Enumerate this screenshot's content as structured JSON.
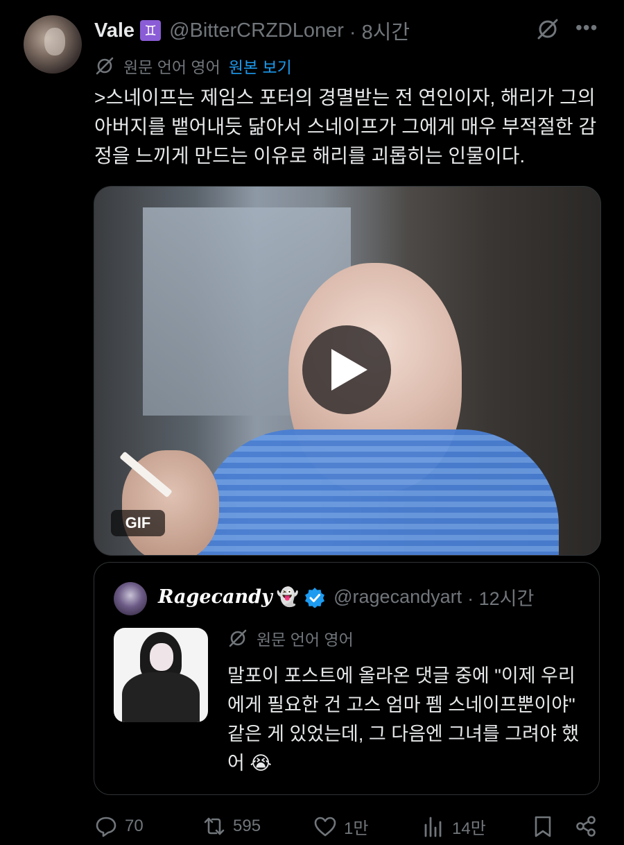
{
  "author": {
    "name": "Vale",
    "zodiac": "♊",
    "handle": "@BitterCRZDLoner",
    "time": "· 8시간"
  },
  "translation": {
    "label": "원문 언어 영어",
    "view_original": "원본 보기"
  },
  "tweet_text": ">스네이프는 제임스 포터의 경멸받는 전 연인이자, 해리가 그의 아버지를 뱉어내듯 닮아서 스네이프가 그에게 매우 부적절한 감정을 느끼게 만드는 이유로 해리를 괴롭히는 인물이다.",
  "media": {
    "badge": "GIF"
  },
  "quote": {
    "name": "Ragecandy",
    "emoji": "👻",
    "handle": "@ragecandyart",
    "time": "· 12시간",
    "translation_label": "원문 언어 영어",
    "text": "말포이 포스트에 올라온 댓글 중에 \"이제 우리에게 필요한 건 고스 엄마 펨 스네이프뿐이야\" 같은 게 있었는데, 그 다음엔 그녀를 그려야 했어 😭"
  },
  "actions": {
    "replies": "70",
    "reposts": "595",
    "likes": "1만",
    "views": "14만"
  },
  "icons": {
    "grok": "slashed-circle-icon",
    "more": "more-icon",
    "reply": "reply-icon",
    "repost": "repost-icon",
    "like": "heart-icon",
    "views": "views-icon",
    "bookmark": "bookmark-icon",
    "share": "share-icon"
  },
  "colors": {
    "background": "#000000",
    "text": "#e7e9ea",
    "muted": "#71767b",
    "link": "#1d9bf0",
    "verified": "#1d9bf0",
    "border": "#2f3336"
  }
}
